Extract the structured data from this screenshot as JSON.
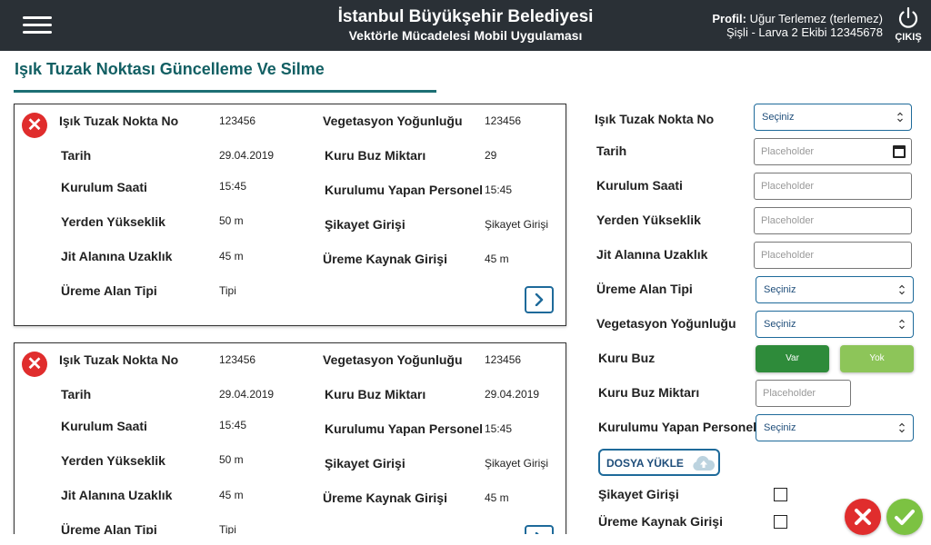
{
  "header": {
    "title": "İstanbul Büyükşehir Belediyesi",
    "subtitle": "Vektörle Mücadelesi Mobil Uygulaması",
    "profile_label": "Profil:",
    "profile_name": "Uğur Terlemez (terlemez)",
    "profile_unit": "Şişli - Larva 2 Ekibi 12345678",
    "logout_label": "ÇIKIŞ"
  },
  "page_title": "Işık Tuzak Noktası Güncelleme Ve Silme",
  "labels": {
    "nokta_no": "Işık Tuzak Nokta No",
    "tarih": "Tarih",
    "kurulum_saati": "Kurulum Saati",
    "yerden_yukseklik": "Yerden Yükseklik",
    "jit_alanina": "Jit Alanına Uzaklık",
    "ureme_alan_tipi": "Üreme Alan Tipi",
    "vegetasyon": "Vegetasyon Yoğunluğu",
    "kuru_buz_miktari": "Kuru Buz Miktarı",
    "kurulumu_yapan": "Kurulumu Yapan Personel",
    "sikayet": "Şikayet Girişi",
    "ureme_kaynak": "Üreme Kaynak Girişi",
    "kuru_buz": "Kuru Buz"
  },
  "records": [
    {
      "nokta_no": "123456",
      "tarih": "29.04.2019",
      "kurulum_saati": "15:45",
      "yerden_yukseklik": "50 m",
      "jit_alanina": "45 m",
      "ureme_alan_tipi": "Tipi",
      "vegetasyon": "123456",
      "kuru_buz_miktari": "29",
      "kurulumu_yapan": "15:45",
      "sikayet": "Şikayet Girişi",
      "ureme_kaynak": "45 m"
    },
    {
      "nokta_no": "123456",
      "tarih": "29.04.2019",
      "kurulum_saati": "15:45",
      "yerden_yukseklik": "50 m",
      "jit_alanina": "45 m",
      "ureme_alan_tipi": "Tipi",
      "vegetasyon": "123456",
      "kuru_buz_miktari": "29.04.2019",
      "kurulumu_yapan": "15:45",
      "sikayet": "Şikayet Girişi",
      "ureme_kaynak": "45 m"
    }
  ],
  "form": {
    "select_placeholder": "Seçiniz",
    "input_placeholder": "Placeholder",
    "var_label": "Var",
    "yok_label": "Yok",
    "upload_label": "DOSYA YÜKLE"
  },
  "icons": {
    "menu": "hamburger-icon",
    "logout": "power-icon",
    "delete": "close-circle-icon",
    "next": "chevron-right-icon",
    "calendar": "calendar-icon",
    "upload": "cloud-upload-icon",
    "cancel": "cancel-icon",
    "confirm": "check-icon"
  },
  "colors": {
    "header_bg": "#2a3036",
    "title": "#125f63",
    "accent": "#1e6a9a",
    "danger": "#e02d2d",
    "success": "#7cc242",
    "var_green": "#2e8b3a",
    "yok_green": "#8dc559"
  }
}
